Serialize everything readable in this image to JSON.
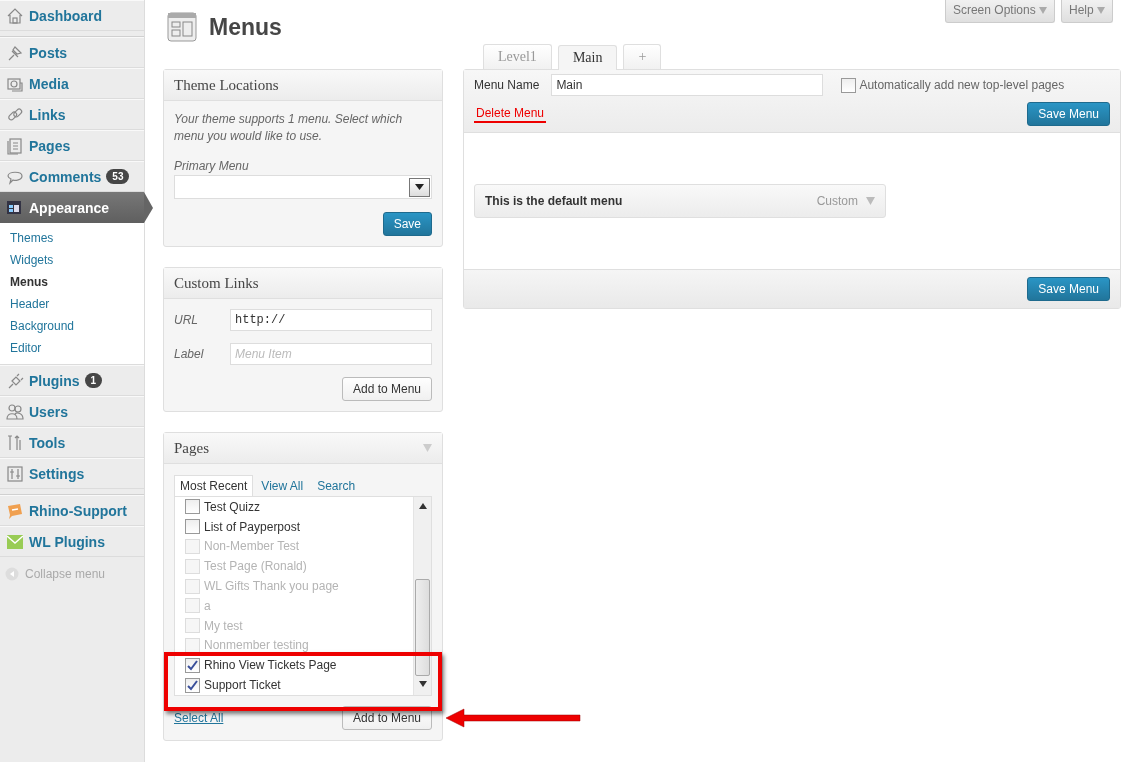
{
  "sidebar": {
    "items": [
      {
        "kind": "item",
        "label": "Dashboard",
        "selected": false
      },
      {
        "kind": "separator"
      },
      {
        "kind": "item",
        "label": "Posts",
        "selected": false
      },
      {
        "kind": "item",
        "label": "Media",
        "selected": false
      },
      {
        "kind": "item",
        "label": "Links",
        "selected": false
      },
      {
        "kind": "item",
        "label": "Pages",
        "selected": false
      },
      {
        "kind": "item",
        "label": "Comments",
        "badge": "53",
        "selected": false
      },
      {
        "kind": "item",
        "label": "Appearance",
        "selected": true,
        "children": [
          {
            "label": "Themes",
            "selected": false
          },
          {
            "label": "Widgets",
            "selected": false
          },
          {
            "label": "Menus",
            "selected": true
          },
          {
            "label": "Header",
            "selected": false
          },
          {
            "label": "Background",
            "selected": false
          },
          {
            "label": "Editor",
            "selected": false
          }
        ]
      },
      {
        "kind": "item",
        "label": "Plugins",
        "badge": "1",
        "selected": false
      },
      {
        "kind": "item",
        "label": "Users",
        "selected": false
      },
      {
        "kind": "item",
        "label": "Tools",
        "selected": false
      },
      {
        "kind": "item",
        "label": "Settings",
        "selected": false
      },
      {
        "kind": "separator"
      },
      {
        "kind": "item",
        "label": "Rhino-Support",
        "selected": false
      },
      {
        "kind": "item",
        "label": "WL Plugins",
        "selected": false
      }
    ],
    "collapse": "Collapse menu"
  },
  "top_buttons": [
    "Screen Options",
    "Help"
  ],
  "page_title": "Menus",
  "theme_locations": {
    "title": "Theme Locations",
    "description": "Your theme supports 1 menu. Select which menu you would like to use.",
    "field_label": "Primary Menu",
    "button": "Save"
  },
  "custom_links": {
    "title": "Custom Links",
    "fields": [
      {
        "label": "URL",
        "value": "http://"
      },
      {
        "label": "Label",
        "placeholder": "Menu Item"
      }
    ],
    "button": "Add to Menu"
  },
  "pages_box": {
    "title": "Pages",
    "tabs": [
      {
        "label": "Most Recent",
        "selected": true
      },
      {
        "label": "View All",
        "selected": false
      },
      {
        "label": "Search",
        "selected": false
      }
    ],
    "items": [
      {
        "label": "Test Quizz",
        "checked": false,
        "disabled": false
      },
      {
        "label": "List of Payperpost",
        "checked": false,
        "disabled": false
      },
      {
        "label": "Non-Member Test",
        "checked": false,
        "disabled": true
      },
      {
        "label": "Test Page (Ronald)",
        "checked": false,
        "disabled": true
      },
      {
        "label": "WL Gifts Thank you page",
        "checked": false,
        "disabled": true
      },
      {
        "label": "a",
        "checked": false,
        "disabled": true
      },
      {
        "label": "My test",
        "checked": false,
        "disabled": true
      },
      {
        "label": "Nonmember testing",
        "checked": false,
        "disabled": true
      }
    ],
    "framed_items": [
      {
        "label": "Rhino View Tickets Page",
        "checked": true,
        "disabled": false
      },
      {
        "label": "Support Ticket",
        "checked": true,
        "disabled": false
      }
    ],
    "highlight_frame": true,
    "select_all": "Select All",
    "button": "Add to Menu",
    "button_arrow": true
  },
  "menu_tabs": [
    {
      "label": "Level1",
      "selected": false
    },
    {
      "label": "Main",
      "selected": true
    },
    {
      "label": "+",
      "selected": false
    }
  ],
  "menu_editor": {
    "name_label": "Menu Name",
    "name_value": "Main",
    "auto_add_label": "Automatically add new top-level pages",
    "auto_add_checked": false,
    "delete_link": "Delete Menu",
    "save_button": "Save Menu",
    "items": [
      {
        "title": "This is the default menu",
        "type": "Custom"
      }
    ],
    "footer_save_button": "Save Menu"
  }
}
